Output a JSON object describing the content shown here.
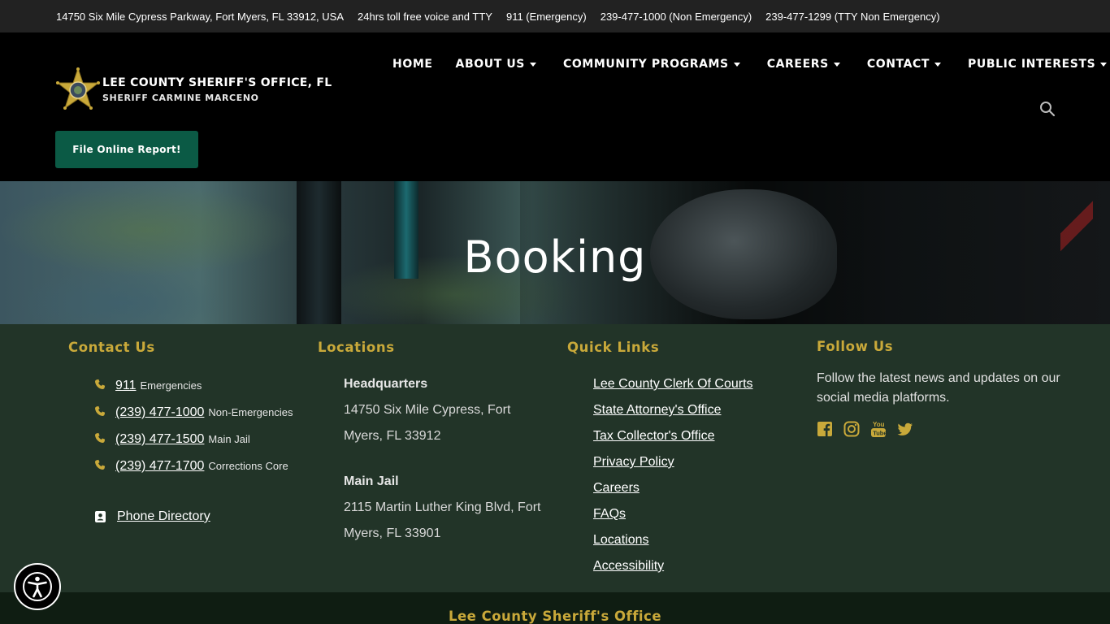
{
  "topbar": {
    "address": "14750 Six Mile Cypress Parkway, Fort Myers, FL 33912, USA",
    "tty": "24hrs toll free voice and TTY",
    "emergency": "911 (Emergency)",
    "non_emergency": "239-477-1000 (Non Emergency)",
    "tty_non_emergency": "239-477-1299 (TTY Non Emergency)"
  },
  "header": {
    "logo_title": "LEE COUNTY SHERIFF'S OFFICE, FL",
    "logo_subtitle": "SHERIFF CARMINE MARCENO",
    "logo_icon": "sheriff-star-badge",
    "report_button": "File Online Report!",
    "search_icon": "search-icon"
  },
  "nav": {
    "items": [
      {
        "label": "HOME",
        "dropdown": false
      },
      {
        "label": "ABOUT US",
        "dropdown": true
      },
      {
        "label": "COMMUNITY PROGRAMS",
        "dropdown": true
      },
      {
        "label": "CAREERS",
        "dropdown": true
      },
      {
        "label": "CONTACT",
        "dropdown": true
      },
      {
        "label": "PUBLIC INTERESTS",
        "dropdown": true
      }
    ]
  },
  "hero": {
    "title": "Booking"
  },
  "footer": {
    "contact": {
      "title": "Contact Us",
      "rows": [
        {
          "number": "911",
          "desc": "Emergencies"
        },
        {
          "number": "(239) 477-1000",
          "desc": "Non-Emergencies"
        },
        {
          "number": "(239) 477-1500",
          "desc": "Main Jail"
        },
        {
          "number": "(239) 477-1700",
          "desc": "Corrections Core"
        }
      ],
      "directory": "Phone Directory"
    },
    "locations": {
      "title": "Locations",
      "headquarters": {
        "name": "Headquarters",
        "line1": "14750 Six Mile Cypress, Fort",
        "line2": "Myers, FL 33912"
      },
      "main_jail": {
        "name": "Main Jail",
        "line1": "2115 Martin Luther King Blvd, Fort",
        "line2": "Myers, FL 33901"
      }
    },
    "quick_links": {
      "title": "Quick Links",
      "links": [
        "Lee County Clerk Of Courts",
        "State Attorney's Office",
        "Tax Collector's Office",
        "Privacy Policy",
        "Careers",
        "FAQs",
        "Locations",
        "Accessibility"
      ]
    },
    "follow": {
      "title": "Follow Us",
      "text": "Follow the latest news and updates on our social media platforms.",
      "icons": [
        "facebook-icon",
        "instagram-icon",
        "youtube-icon",
        "twitter-icon"
      ]
    }
  },
  "bottom": {
    "title": "Lee County Sheriff's Office"
  },
  "colors": {
    "accent_gold": "#c9a93a",
    "footer_green": "#223428",
    "button_green": "#0b5a45",
    "topbar": "#222222"
  }
}
